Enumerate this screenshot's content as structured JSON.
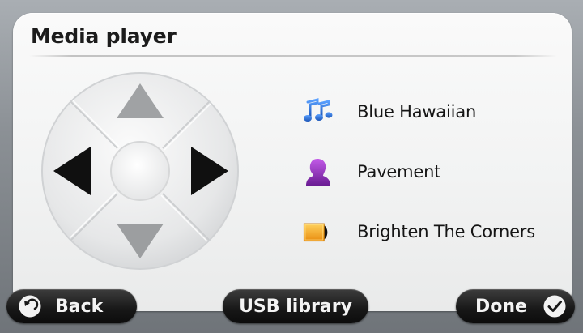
{
  "screen": {
    "title": "Media player"
  },
  "tracks": [
    {
      "label": "Blue Hawaiian",
      "icon": "music-notes-icon"
    },
    {
      "label": "Pavement",
      "icon": "artist-silhouette-icon"
    },
    {
      "label": "Brighten The Corners",
      "icon": "album-cd-icon"
    }
  ],
  "buttons": {
    "back_label": "Back",
    "usb_label": "USB library",
    "done_label": "Done"
  },
  "dpad": {
    "up_icon": "arrow-up-icon",
    "down_icon": "arrow-down-icon",
    "left_icon": "arrow-left-icon",
    "right_icon": "arrow-right-icon",
    "up_enabled": false,
    "down_enabled": false,
    "left_enabled": true,
    "right_enabled": true
  },
  "colors": {
    "panel_background": "#f2f3f3",
    "button_background": "#171717",
    "button_text": "#f4f4f4",
    "arrow_active": "#111111",
    "arrow_disabled": "#9a9c9e",
    "icon_blue": "#2f6fd1",
    "icon_purple": "#8e2bb5",
    "icon_orange": "#f3a21f"
  }
}
